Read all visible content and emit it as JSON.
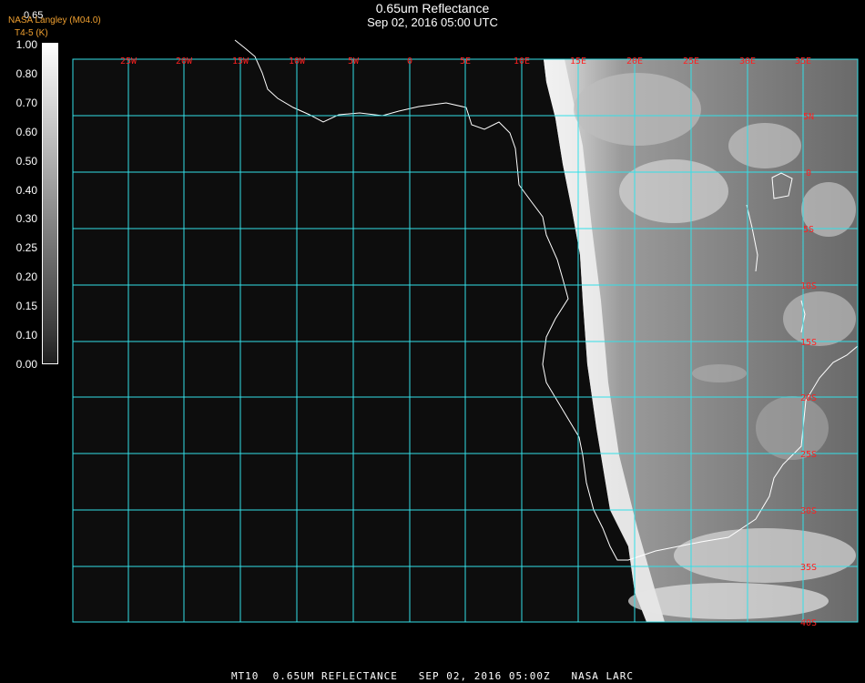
{
  "header": {
    "title": "0.65um Reflectance",
    "subtitle": "Sep 02, 2016 05:00 UTC"
  },
  "corner": {
    "org": "NASA Langley (M04.0)",
    "product": "T4-5 (K)",
    "top_value": "0.65"
  },
  "colorbar": {
    "labels": [
      "1.00",
      "0.80",
      "0.70",
      "0.60",
      "0.50",
      "0.40",
      "0.30",
      "0.25",
      "0.20",
      "0.15",
      "0.10",
      "0.00"
    ],
    "colors": [
      "#ffffff",
      "#ebebeb",
      "#d8d8d8",
      "#c4c4c4",
      "#b0b0b0",
      "#9c9c9c",
      "#888888",
      "#747474",
      "#606060",
      "#4c4c4c",
      "#383838",
      "#1e1e1e"
    ]
  },
  "map": {
    "grid_color": "#33e0e8",
    "label_color": "#ff2020",
    "lon_labels": [
      "25W",
      "20W",
      "15W",
      "10W",
      "5W",
      "0",
      "5E",
      "10E",
      "15E",
      "20E",
      "25E",
      "30E",
      "35E"
    ],
    "lat_labels": [
      "5N",
      "0",
      "5S",
      "10S",
      "15S",
      "20S",
      "25S",
      "30S",
      "35S",
      "40S"
    ]
  },
  "footer": {
    "text": "MT10  0.65UM REFLECTANCE   SEP 02, 2016 05:00Z   NASA LARC"
  }
}
